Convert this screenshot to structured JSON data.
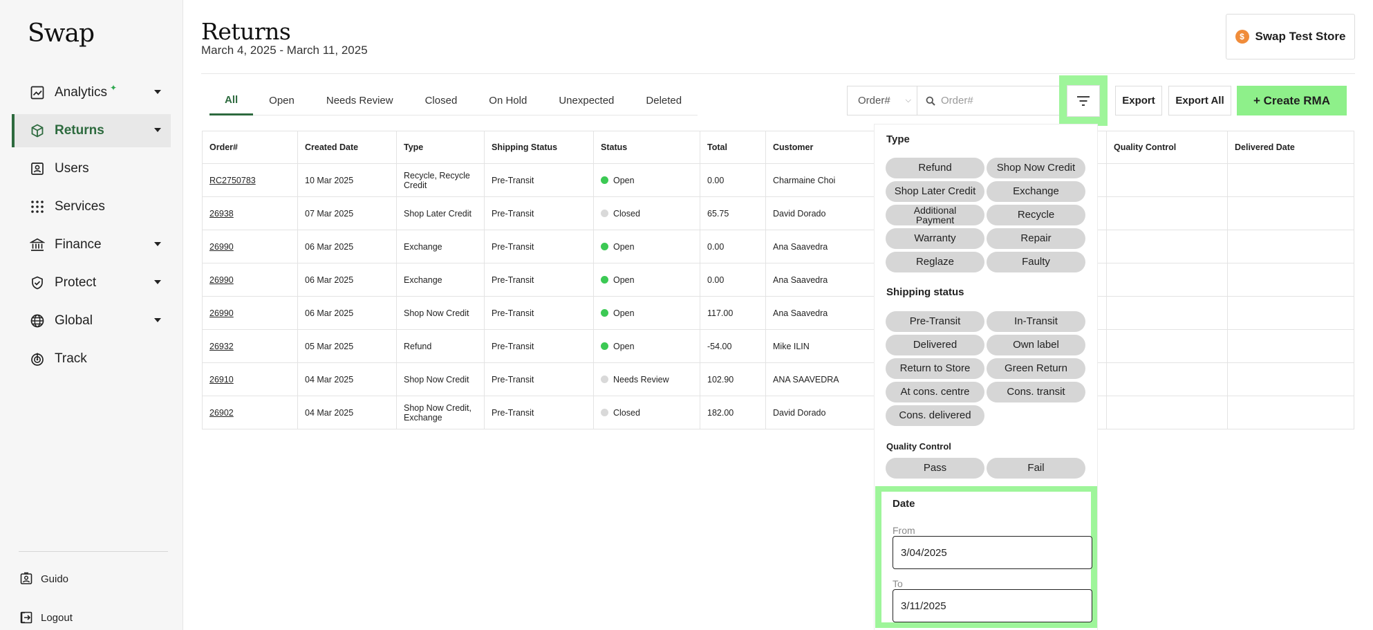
{
  "app": {
    "logo": "Swap",
    "store_name": "Swap Test Store",
    "store_icon": "$"
  },
  "sidebar": {
    "items": [
      {
        "label": "Analytics",
        "icon": "chart-icon",
        "has_caret": true,
        "badge": "✦"
      },
      {
        "label": "Returns",
        "icon": "box-icon",
        "has_caret": true,
        "active": true
      },
      {
        "label": "Users",
        "icon": "user-badge-icon",
        "has_caret": false
      },
      {
        "label": "Services",
        "icon": "grid-dots-icon",
        "has_caret": false
      },
      {
        "label": "Finance",
        "icon": "bank-icon",
        "has_caret": true
      },
      {
        "label": "Protect",
        "icon": "shield-icon",
        "has_caret": true
      },
      {
        "label": "Global",
        "icon": "globe-icon",
        "has_caret": true
      },
      {
        "label": "Track",
        "icon": "target-icon",
        "has_caret": false
      }
    ],
    "user": "Guido",
    "logout": "Logout"
  },
  "header": {
    "title": "Returns",
    "subtitle": "March 4, 2025 - March 11, 2025"
  },
  "tabs": [
    "All",
    "Open",
    "Needs Review",
    "Closed",
    "On Hold",
    "Unexpected",
    "Deleted"
  ],
  "toolbar": {
    "search_field_select": "Order#",
    "search_placeholder": "Order#",
    "export_label": "Export",
    "export_all_label": "Export All",
    "create_label": "+ Create RMA"
  },
  "table": {
    "columns": [
      "Order#",
      "Created Date",
      "Type",
      "Shipping Status",
      "Status",
      "Total",
      "Customer",
      "",
      "Quality Control",
      "Delivered Date"
    ],
    "rows": [
      {
        "order": "RC2750783",
        "date": "10 Mar 2025",
        "type": "Recycle, Recycle Credit",
        "shipping": "Pre-Transit",
        "status": "Open",
        "total": "0.00",
        "customer": "Charmaine Choi"
      },
      {
        "order": "26938",
        "date": "07 Mar 2025",
        "type": "Shop Later Credit",
        "shipping": "Pre-Transit",
        "status": "Closed",
        "total": "65.75",
        "customer": "David Dorado"
      },
      {
        "order": "26990",
        "date": "06 Mar 2025",
        "type": "Exchange",
        "shipping": "Pre-Transit",
        "status": "Open",
        "total": "0.00",
        "customer": "Ana Saavedra"
      },
      {
        "order": "26990",
        "date": "06 Mar 2025",
        "type": "Exchange",
        "shipping": "Pre-Transit",
        "status": "Open",
        "total": "0.00",
        "customer": "Ana Saavedra"
      },
      {
        "order": "26990",
        "date": "06 Mar 2025",
        "type": "Shop Now Credit",
        "shipping": "Pre-Transit",
        "status": "Open",
        "total": "117.00",
        "customer": "Ana Saavedra"
      },
      {
        "order": "26932",
        "date": "05 Mar 2025",
        "type": "Refund",
        "shipping": "Pre-Transit",
        "status": "Open",
        "total": "-54.00",
        "customer": "Mike ILIN"
      },
      {
        "order": "26910",
        "date": "04 Mar 2025",
        "type": "Shop Now Credit",
        "shipping": "Pre-Transit",
        "status": "Needs Review",
        "total": "102.90",
        "customer": "ANA SAAVEDRA"
      },
      {
        "order": "26902",
        "date": "04 Mar 2025",
        "type": "Shop Now Credit, Exchange",
        "shipping": "Pre-Transit",
        "status": "Closed",
        "total": "182.00",
        "customer": "David Dorado"
      }
    ]
  },
  "status_colors": {
    "Open": "#3cc954",
    "Closed": "#d9d9d9",
    "Needs Review": "#d9d9d9"
  },
  "filters": {
    "type_heading": "Type",
    "type_options": [
      "Refund",
      "Shop Now Credit",
      "Shop Later Credit",
      "Exchange",
      "Additional Payment",
      "Recycle",
      "Warranty",
      "Repair",
      "Reglaze",
      "Faulty"
    ],
    "shipping_heading": "Shipping status",
    "shipping_options": [
      "Pre-Transit",
      "In-Transit",
      "Delivered",
      "Own label",
      "Return to Store",
      "Green Return",
      "At cons. centre",
      "Cons. transit",
      "Cons. delivered"
    ],
    "qc_heading": "Quality Control",
    "qc_options": [
      "Pass",
      "Fail"
    ],
    "date_heading": "Date",
    "from_label": "From",
    "from_value": "3/04/2025",
    "to_label": "To",
    "to_value": "3/11/2025"
  },
  "colors": {
    "accent": "#2d6a3e",
    "highlight": "#9ef59a",
    "create_button": "#8ef08a"
  }
}
